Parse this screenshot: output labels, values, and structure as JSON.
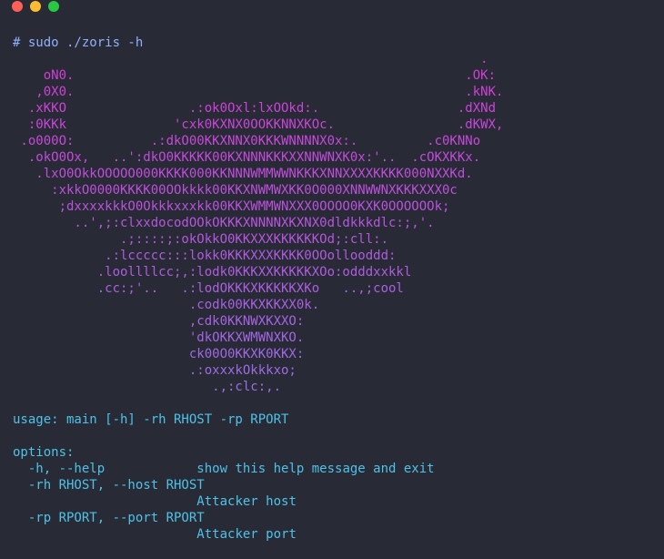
{
  "window": {
    "buttons": {
      "close_color": "#ff5f57",
      "minimize_color": "#febc2e",
      "maximize_color": "#28c840"
    }
  },
  "colors": {
    "background": "#282a36",
    "prompt": "#8fb0ff",
    "art_top": "#d63bd6",
    "art_bottom": "#9a6ee6",
    "help_text": "#4ec2e8"
  },
  "terminal": {
    "prompt_line": "# sudo ./zoris -h",
    "ascii_art": [
      "                                                             .",
      "    oN0.                                                   .OK:",
      "   ,0X0.                                                   .kNK.",
      "  .xKKO                .:ok0Oxl:lxOOkd:.                  .dXNd",
      "  :0KKk              'cxk0KXNX0OOKKNNXKOc.                .dKWX,",
      " .o000O:          .:dkO00KKXNNX0KKKWNNNNX0x:.         .c0KNNo",
      "  .okO0Ox,   ..':dkO0KKKKK00KXNNNKKKXXNNWNXK0x:'..  .cOKXKKx.",
      "   .lxO0OkkOOOOO000KKKK000KKNNNWMMWWNKKKXNNXXXXKKKK000NXXKd.",
      "     :xkkO0000KKKK00OOkkkk00KKXNWMWXKK0O000XNNWWNXKKKXXX0c",
      "      ;dxxxxkkkO0Okkkxxxkk00KKXWMMWNXXX0OOOO0KXK0OOOOOOk;",
      "        ..',;:clxxdocodOOkOKKKXNNNNXKXNX0dldkkkdlc:;,'.",
      "              .;::::;:okOkkO0KKXXXKKKKKKOd;:cll:.",
      "            .:lccccc:::lokk0KKKXXXKKKK0OOollooddd:",
      "           .loollllcc;,:lodk0KKKXXKKKKKXOo:odddxxkkl",
      "           .cc:;'..   .:lodOKKKXKKKKKXKo   ..,;cool",
      "                       .codk00KKXKKXX0k.",
      "                       ,cdk0KKNWXKXXO:",
      "                       'dkOKKXWMWNXKO.",
      "                       ck00O0KKXK0KKX:",
      "                       .:oxxxkOkkkxo;",
      "                          .,:clc:,."
    ],
    "usage_line": "usage: main [-h] -rh RHOST -rp RPORT",
    "options_header": "options:",
    "options": [
      {
        "flag": "  -h, --help            ",
        "desc": "show this help message and exit"
      },
      {
        "flag": "  -rh RHOST, --host RHOST",
        "desc": ""
      },
      {
        "flag": "                        ",
        "desc": "Attacker host"
      },
      {
        "flag": "  -rp RPORT, --port RPORT",
        "desc": ""
      },
      {
        "flag": "                        ",
        "desc": "Attacker port"
      }
    ]
  }
}
